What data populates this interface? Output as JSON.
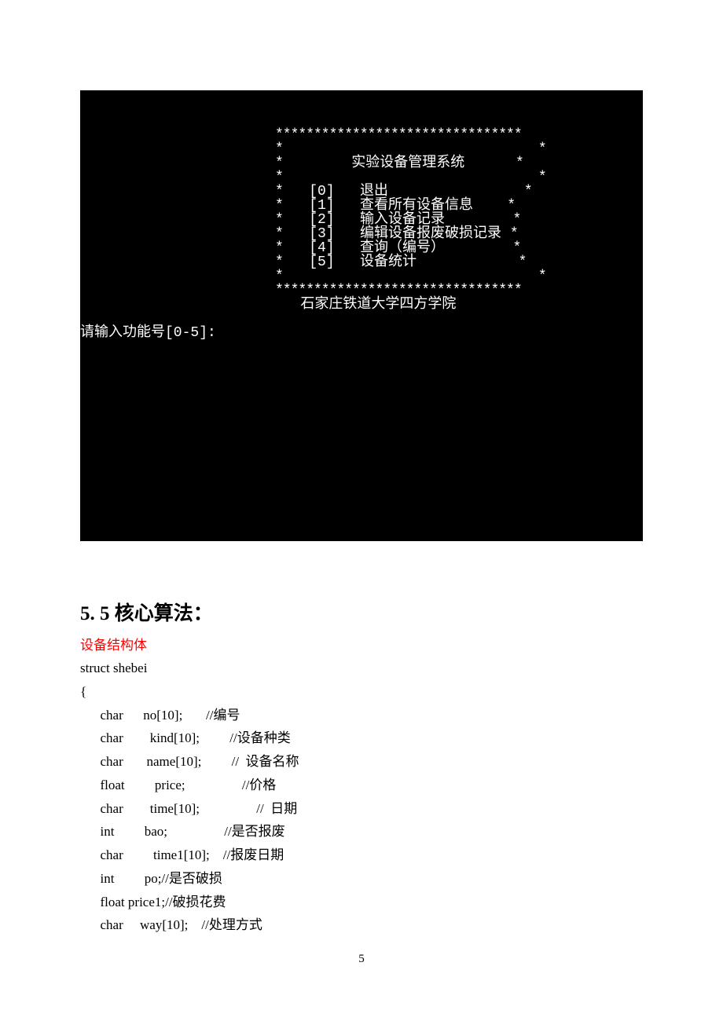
{
  "terminal": {
    "border_top": "********************************",
    "blank_row_left": "*",
    "blank_row_right": "*",
    "title": "实验设备管理系统",
    "menu": [
      {
        "key": "[0]",
        "label": "退出"
      },
      {
        "key": "[1]",
        "label": "查看所有设备信息"
      },
      {
        "key": "[2]",
        "label": "输入设备记录"
      },
      {
        "key": "[3]",
        "label": "编辑设备报废破损记录"
      },
      {
        "key": "[4]",
        "label": "查询（编号）"
      },
      {
        "key": "[5]",
        "label": "设备统计"
      }
    ],
    "border_bottom": "********************************",
    "footer": "石家庄铁道大学四方学院",
    "prompt": "请输入功能号[0-5]:"
  },
  "section": {
    "heading": "5. 5 核心算法：",
    "subhead": "设备结构体",
    "code_lines": [
      "struct shebei",
      "{",
      "      char      no[10];       //编号",
      "      char        kind[10];         //设备种类",
      "      char       name[10];         //  设备名称",
      "      float         price;                 //价格",
      "      char        time[10];                 //  日期",
      "      int         bao;                 //是否报废",
      "      char         time1[10];    //报废日期",
      "      int         po;//是否破损",
      "      float price1;//破损花费",
      "      char     way[10];    //处理方式"
    ]
  },
  "page_number": "5"
}
